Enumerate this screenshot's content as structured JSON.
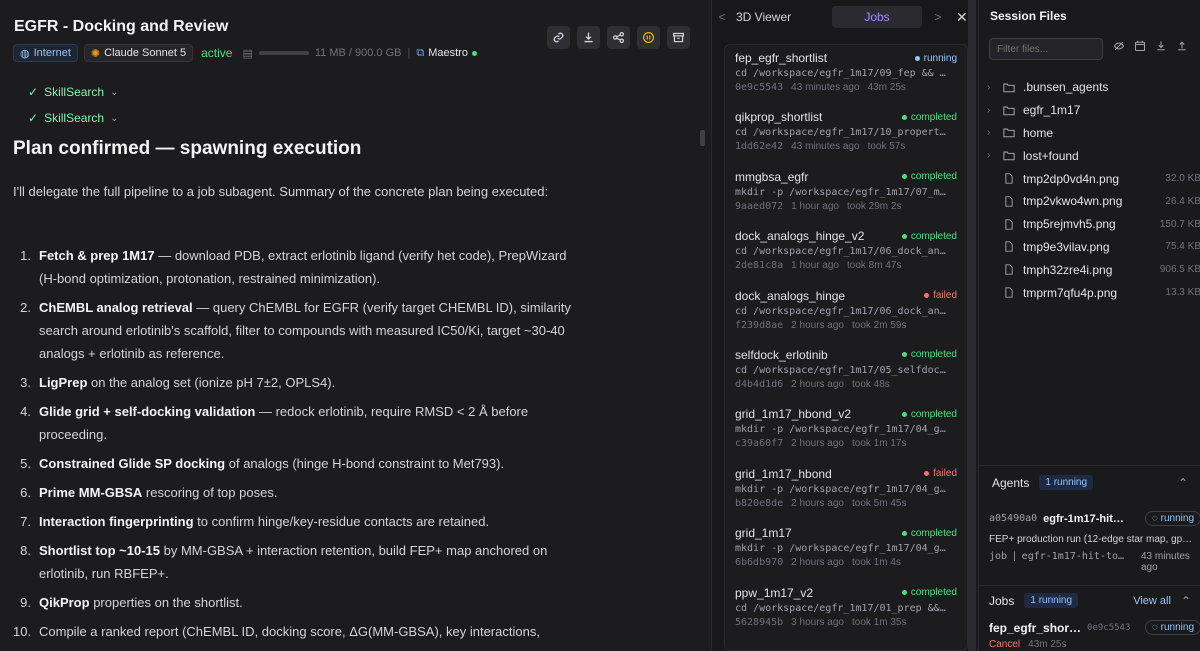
{
  "header": {
    "title": "EGFR - Docking and Review",
    "internet": "Internet",
    "model": "Claude Sonnet 5",
    "status": "active",
    "storage": "11 MB / 900.0 GB",
    "maestro": "Maestro"
  },
  "skills": [
    "SkillSearch",
    "SkillSearch"
  ],
  "plan": {
    "heading": "Plan confirmed — spawning execution",
    "intro": "I'll delegate the full pipeline to a job subagent. Summary of the concrete plan being executed:",
    "steps": [
      {
        "num": "1.",
        "bold": "Fetch & prep 1M17",
        "text": " — download PDB, extract erlotinib ligand (verify het code), PrepWizard (H-bond optimization, protonation, restrained minimization)."
      },
      {
        "num": "2.",
        "bold": "ChEMBL analog retrieval",
        "text": " — query ChEMBL for EGFR (verify target CHEMBL ID), similarity search around erlotinib's scaffold, filter to compounds with measured IC50/Ki, target ~30-40 analogs + erlotinib as reference."
      },
      {
        "num": "3.",
        "bold": "LigPrep",
        "text": " on the analog set (ionize pH 7±2, OPLS4)."
      },
      {
        "num": "4.",
        "bold": "Glide grid + self-docking validation",
        "text": " — redock erlotinib, require RMSD < 2 Å before proceeding."
      },
      {
        "num": "5.",
        "bold": "Constrained Glide SP docking",
        "text": " of analogs (hinge H-bond constraint to Met793)."
      },
      {
        "num": "6.",
        "bold": "Prime MM-GBSA",
        "text": " rescoring of top poses."
      },
      {
        "num": "7.",
        "bold": "Interaction fingerprinting",
        "text": " to confirm hinge/key-residue contacts are retained."
      },
      {
        "num": "8.",
        "bold": "Shortlist top ~10-15",
        "text": " by MM-GBSA + interaction retention, build FEP+ map anchored on erlotinib, run RBFEP+."
      },
      {
        "num": "9.",
        "bold": "QikProp",
        "text": " properties on the shortlist."
      },
      {
        "num": "10.",
        "bold": "",
        "text": "Compile a ranked report (ChEMBL ID, docking score, ΔG(MM-GBSA), key interactions,"
      }
    ]
  },
  "mid": {
    "tab_viewer": "3D Viewer",
    "tab_jobs": "Jobs",
    "jobs": [
      {
        "name": "fep_egfr_shortlist",
        "status": "running",
        "cmd": "cd /workspace/egfr_1m17/09_fep && …",
        "id": "0e9c5543",
        "ago": "43 minutes ago",
        "dur": "43m 25s"
      },
      {
        "name": "qikprop_shortlist",
        "status": "completed",
        "cmd": "cd /workspace/egfr_1m17/10_propert…",
        "id": "1dd62e42",
        "ago": "43 minutes ago",
        "dur": "took 57s"
      },
      {
        "name": "mmgbsa_egfr",
        "status": "completed",
        "cmd": "mkdir -p /workspace/egfr_1m17/07_m…",
        "id": "9aaed072",
        "ago": "1 hour ago",
        "dur": "took 29m 2s"
      },
      {
        "name": "dock_analogs_hinge_v2",
        "status": "completed",
        "cmd": "cd /workspace/egfr_1m17/06_dock_an…",
        "id": "2de81c8a",
        "ago": "1 hour ago",
        "dur": "took 8m 47s"
      },
      {
        "name": "dock_analogs_hinge",
        "status": "failed",
        "cmd": "cd /workspace/egfr_1m17/06_dock_an…",
        "id": "f239d8ae",
        "ago": "2 hours ago",
        "dur": "took 2m 59s"
      },
      {
        "name": "selfdock_erlotinib",
        "status": "completed",
        "cmd": "cd /workspace/egfr_1m17/05_selfdoc…",
        "id": "d4b4d1d6",
        "ago": "2 hours ago",
        "dur": "took 48s"
      },
      {
        "name": "grid_1m17_hbond_v2",
        "status": "completed",
        "cmd": "mkdir -p /workspace/egfr_1m17/04_g…",
        "id": "c39a60f7",
        "ago": "2 hours ago",
        "dur": "took 1m 17s"
      },
      {
        "name": "grid_1m17_hbond",
        "status": "failed",
        "cmd": "mkdir -p /workspace/egfr_1m17/04_g…",
        "id": "b820e8de",
        "ago": "2 hours ago",
        "dur": "took 5m 45s"
      },
      {
        "name": "grid_1m17",
        "status": "completed",
        "cmd": "mkdir -p /workspace/egfr_1m17/04_g…",
        "id": "6b6db970",
        "ago": "2 hours ago",
        "dur": "took 1m 4s"
      },
      {
        "name": "ppw_1m17_v2",
        "status": "completed",
        "cmd": "cd /workspace/egfr_1m17/01_prep &&…",
        "id": "5628945b",
        "ago": "3 hours ago",
        "dur": "took 1m 35s"
      }
    ]
  },
  "files": {
    "title": "Session Files",
    "placeholder": "Filter files...",
    "folders": [
      ".bunsen_agents",
      "egfr_1m17",
      "home",
      "lost+found"
    ],
    "items": [
      {
        "name": "tmp2dp0vd4n.png",
        "size": "32.0 KB"
      },
      {
        "name": "tmp2vkwo4wn.png",
        "size": "26.4 KB"
      },
      {
        "name": "tmp5rejmvh5.png",
        "size": "150.7 KB"
      },
      {
        "name": "tmp9e3vilav.png",
        "size": "75.4 KB"
      },
      {
        "name": "tmph32zre4i.png",
        "size": "906.5 KB"
      },
      {
        "name": "tmprm7qfu4p.png",
        "size": "13.3 KB"
      }
    ]
  },
  "agents": {
    "label": "Agents",
    "badge": "1 running",
    "agent_id": "a05490a0",
    "agent_name": "egfr-1m17-hit…",
    "agent_status": "running",
    "agent_desc": "FEP+ production run (12-edge star map, gp…",
    "agent_type": "job",
    "agent_ref": "egfr-1m17-hit-to…",
    "agent_time": "43 minutes ago"
  },
  "jobs_panel": {
    "label": "Jobs",
    "badge": "1 running",
    "view_all": "View all",
    "job_name": "fep_egfr_shor…",
    "job_id": "0e9c5543",
    "job_status": "running",
    "cancel": "Cancel",
    "time": "43m 25s"
  }
}
